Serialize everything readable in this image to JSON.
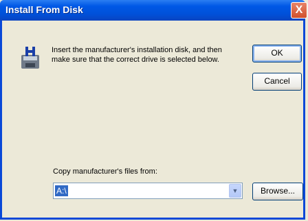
{
  "window": {
    "title": "Install From Disk",
    "close_glyph": "X"
  },
  "message": "Insert the manufacturer's installation disk, and then make sure that the correct drive is selected below.",
  "buttons": {
    "ok": "OK",
    "cancel": "Cancel",
    "browse": "Browse..."
  },
  "copy_from": {
    "label": "Copy manufacturer's files from:",
    "value": "A:\\",
    "arrow_glyph": "▼"
  },
  "icons": {
    "disk": "floppy-disk-install-icon"
  },
  "colors": {
    "title_bar": "#0058e6",
    "close_button": "#d0502c",
    "dialog_bg": "#ece9d8",
    "selection": "#316ac5"
  }
}
